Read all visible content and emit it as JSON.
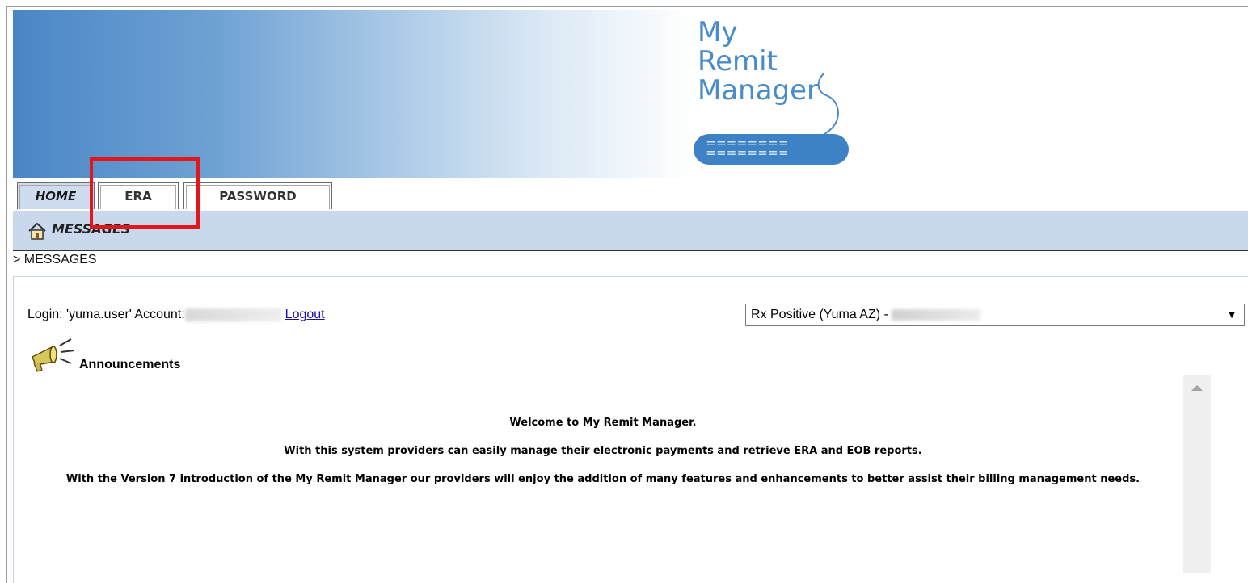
{
  "logo": {
    "line1": "My",
    "line2": "Remit",
    "line3": "Manager",
    "keyboard": "========"
  },
  "tabs": [
    {
      "label": "HOME",
      "active": true
    },
    {
      "label": "ERA",
      "active": false
    },
    {
      "label": "PASSWORD",
      "active": false
    }
  ],
  "messages_bar": {
    "label": "MESSAGES",
    "icon": "home-icon"
  },
  "breadcrumb": "> MESSAGES",
  "login": {
    "prefix": "Login: 'yuma.user' Account:",
    "logout": "Logout"
  },
  "account_select": {
    "value": "Rx Positive (Yuma AZ) -"
  },
  "announcements": {
    "title": "Announcements",
    "icon": "megaphone-icon",
    "paragraphs": [
      "Welcome to My Remit Manager.",
      "With this system providers can easily manage their electronic payments and retrieve ERA and EOB reports.",
      "With the Version 7 introduction of the My Remit Manager our providers will enjoy the addition of many features and enhancements to better assist their billing management needs."
    ]
  },
  "colors": {
    "highlight": "#e3161b",
    "bar": "#cad8ed",
    "brand": "#4a8bc9"
  }
}
